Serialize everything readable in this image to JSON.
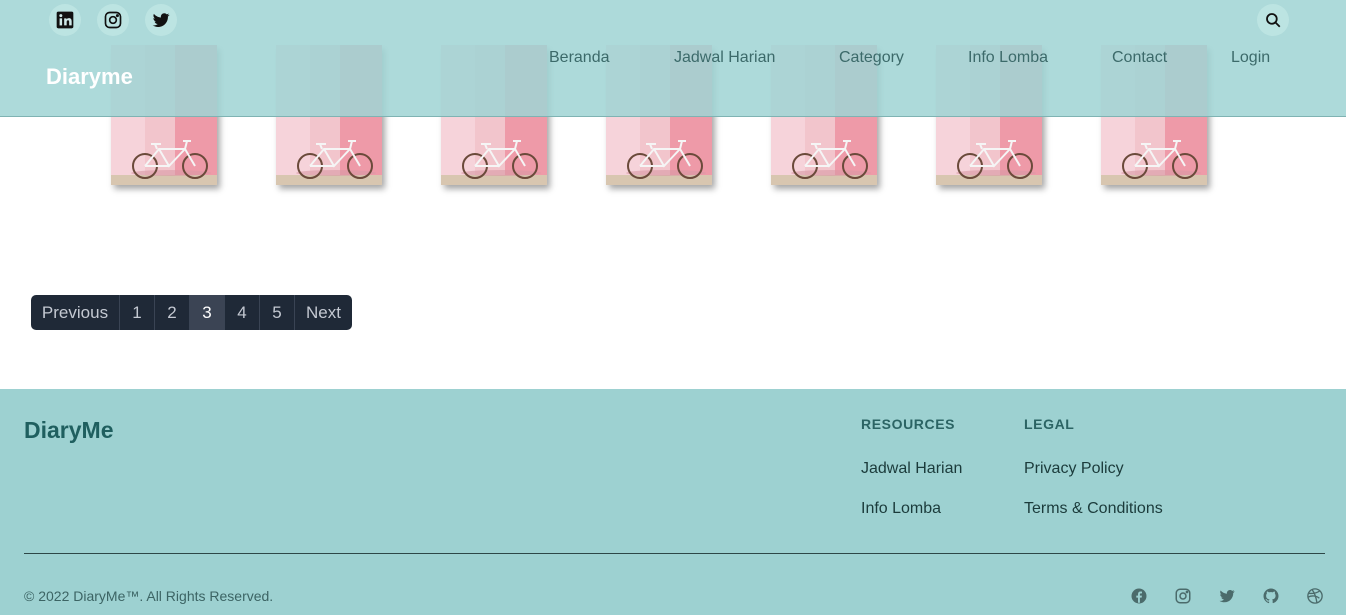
{
  "header": {
    "brand": "Diaryme",
    "social_icons": [
      "linkedin-icon",
      "instagram-icon",
      "twitter-icon"
    ],
    "search_icon": "search-icon",
    "nav": [
      "Beranda",
      "Jadwal Harian",
      "Category",
      "Info Lomba",
      "Contact",
      "Login"
    ]
  },
  "gallery": {
    "image_count": 7,
    "image_description_icon": "bicycle-pink-wall-photo"
  },
  "pagination": {
    "previous": "Previous",
    "pages": [
      "1",
      "2",
      "3",
      "4",
      "5"
    ],
    "active_page": "3",
    "next": "Next"
  },
  "footer": {
    "brand": "DiaryMe",
    "resources": {
      "heading": "RESOURCES",
      "links": [
        "Jadwal Harian",
        "Info Lomba"
      ]
    },
    "legal": {
      "heading": "LEGAL",
      "links": [
        "Privacy Policy",
        "Terms & Conditions"
      ]
    },
    "copyright": "© 2022 DiaryMe™. All Rights Reserved.",
    "icons": [
      "facebook-icon",
      "instagram-icon",
      "twitter-icon",
      "github-icon",
      "dribbble-icon"
    ]
  },
  "colors": {
    "header_bg": "#a0d4d4",
    "footer_bg": "#9dd1d1",
    "pagination_bg": "#1f2937",
    "brand_dark": "#1f5f5f"
  }
}
